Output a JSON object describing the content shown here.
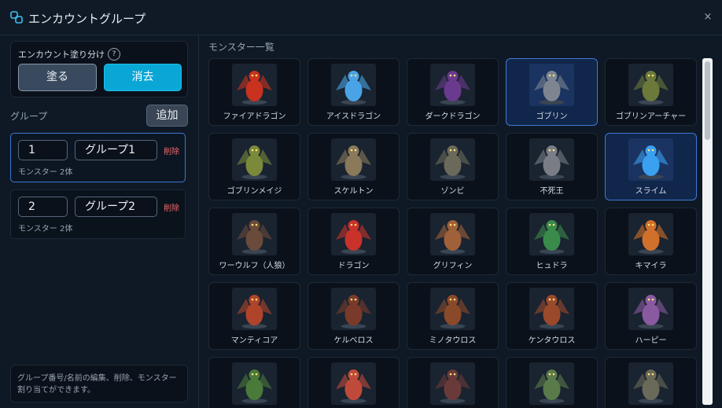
{
  "window": {
    "title": "エンカウントグループ",
    "close_glyph": "×"
  },
  "paint": {
    "label": "エンカウント塗り分け",
    "help_glyph": "?",
    "paint_label": "塗る",
    "erase_label": "消去"
  },
  "groups": {
    "heading": "グループ",
    "add_label": "追加",
    "items": [
      {
        "number": "1",
        "name": "グループ1",
        "delete_label": "削除",
        "count": "モンスター 2体",
        "selected": true
      },
      {
        "number": "2",
        "name": "グループ2",
        "delete_label": "削除",
        "count": "モンスター 2体",
        "selected": false
      }
    ]
  },
  "help_note": "グループ番号/名前の編集、削除、モンスター割り当てができます。",
  "monsters": {
    "heading": "モンスター一覧",
    "items": [
      {
        "name": "ファイアドラゴン",
        "selected": false,
        "icon": "fire-dragon",
        "color": "#c8321e"
      },
      {
        "name": "アイスドラゴン",
        "selected": false,
        "icon": "ice-dragon",
        "color": "#4aa3e6"
      },
      {
        "name": "ダークドラゴン",
        "selected": false,
        "icon": "dark-dragon",
        "color": "#6a3a8e"
      },
      {
        "name": "ゴブリン",
        "selected": true,
        "icon": "goblin",
        "color": "#7c8590"
      },
      {
        "name": "ゴブリンアーチャー",
        "selected": false,
        "icon": "goblin-archer",
        "color": "#6b7a3a"
      },
      {
        "name": "ゴブリンメイジ",
        "selected": false,
        "icon": "goblin-mage",
        "color": "#7a8a3a"
      },
      {
        "name": "スケルトン",
        "selected": false,
        "icon": "skeleton",
        "color": "#8a7a5a"
      },
      {
        "name": "ゾンビ",
        "selected": false,
        "icon": "zombie",
        "color": "#6b6a5a"
      },
      {
        "name": "不死王",
        "selected": false,
        "icon": "undead-king",
        "color": "#7a7d86"
      },
      {
        "name": "スライム",
        "selected": true,
        "icon": "slime",
        "color": "#3aa0f0"
      },
      {
        "name": "ワーウルフ（人狼）",
        "selected": false,
        "icon": "werewolf",
        "color": "#6a4a3a"
      },
      {
        "name": "ドラゴン",
        "selected": false,
        "icon": "dragon",
        "color": "#c8322a"
      },
      {
        "name": "グリフィン",
        "selected": false,
        "icon": "griffin",
        "color": "#a0603a"
      },
      {
        "name": "ヒュドラ",
        "selected": false,
        "icon": "hydra",
        "color": "#3a8a4a"
      },
      {
        "name": "キマイラ",
        "selected": false,
        "icon": "chimera",
        "color": "#d0702a"
      },
      {
        "name": "マンティコア",
        "selected": false,
        "icon": "manticore",
        "color": "#b0442a"
      },
      {
        "name": "ケルベロス",
        "selected": false,
        "icon": "cerberus",
        "color": "#7a3a2a"
      },
      {
        "name": "ミノタウロス",
        "selected": false,
        "icon": "minotaur",
        "color": "#8a4a2a"
      },
      {
        "name": "ケンタウロス",
        "selected": false,
        "icon": "centaur",
        "color": "#9a4a2a"
      },
      {
        "name": "ハーピー",
        "selected": false,
        "icon": "harpy",
        "color": "#8a5aa0"
      },
      {
        "name": "",
        "selected": false,
        "icon": "orc",
        "color": "#4a7a3a"
      },
      {
        "name": "",
        "selected": false,
        "icon": "bird-beast",
        "color": "#c04a3a"
      },
      {
        "name": "",
        "selected": false,
        "icon": "vampire",
        "color": "#6a3a3a"
      },
      {
        "name": "",
        "selected": false,
        "icon": "ghoul",
        "color": "#5a7a4a"
      },
      {
        "name": "",
        "selected": false,
        "icon": "troll",
        "color": "#6a6a5a"
      }
    ]
  }
}
